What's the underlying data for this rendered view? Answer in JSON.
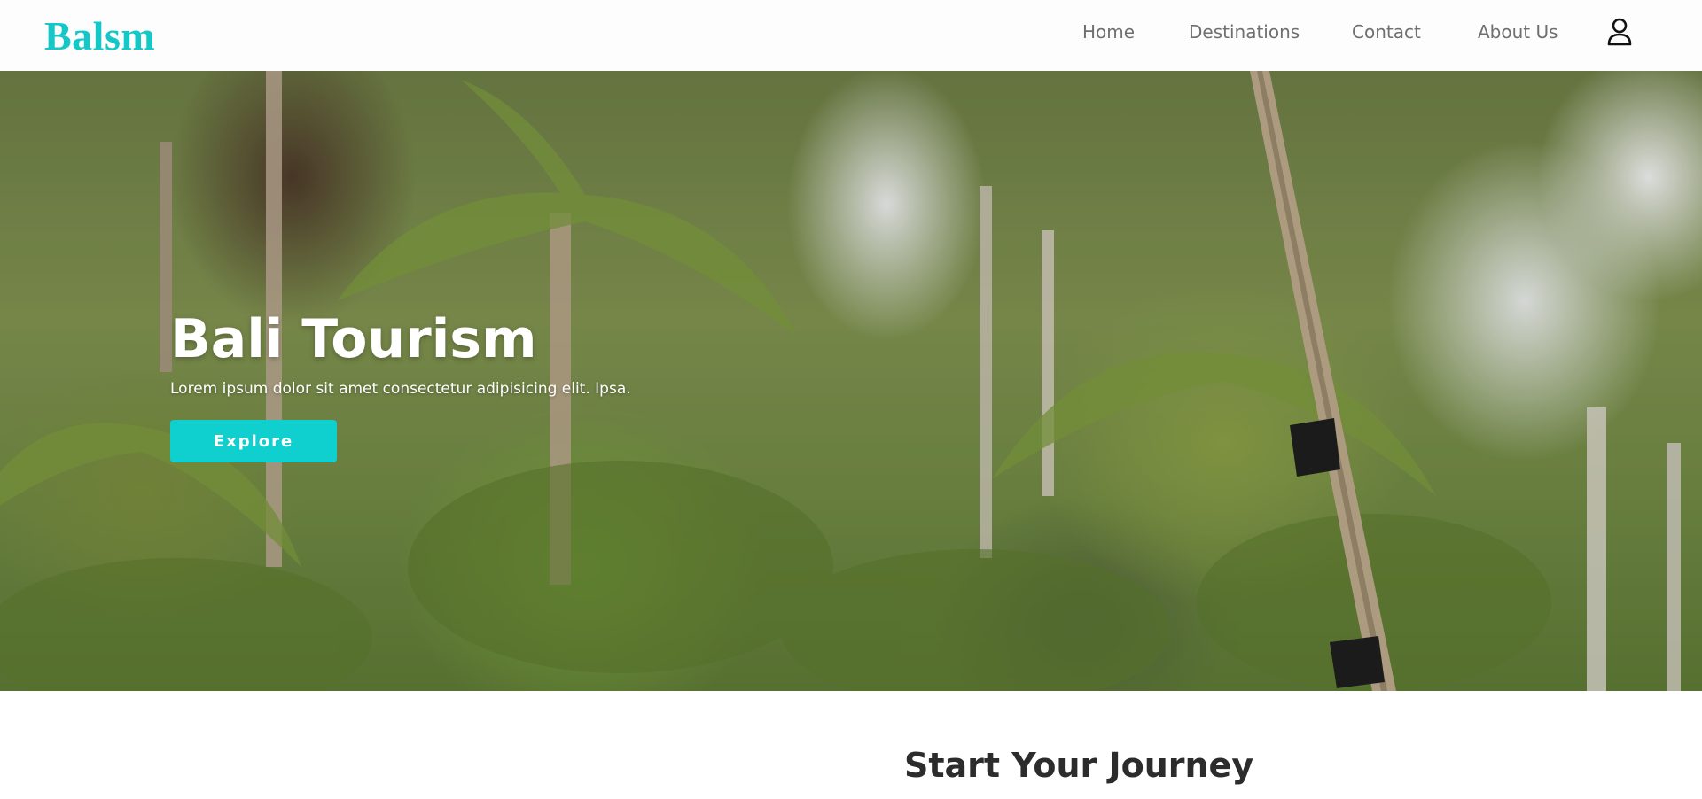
{
  "header": {
    "logo": "Balsm",
    "nav": [
      {
        "label": "Home"
      },
      {
        "label": "Destinations"
      },
      {
        "label": "Contact"
      },
      {
        "label": "About Us"
      }
    ],
    "user_icon": "user-icon"
  },
  "hero": {
    "title_bold": "Bali",
    "title_light": "Tourism",
    "subtitle": "Lorem ipsum dolor sit amet consectetur adipisicing elit. Ipsa.",
    "button_label": "Explore",
    "background": "palm-trees-photo"
  },
  "section": {
    "title": "Start Your Journey"
  },
  "colors": {
    "accent": "#0fcfcf",
    "logo": "#14c8c8",
    "nav_text": "#6f6f6f",
    "heading_dark": "#2c2c2c"
  }
}
